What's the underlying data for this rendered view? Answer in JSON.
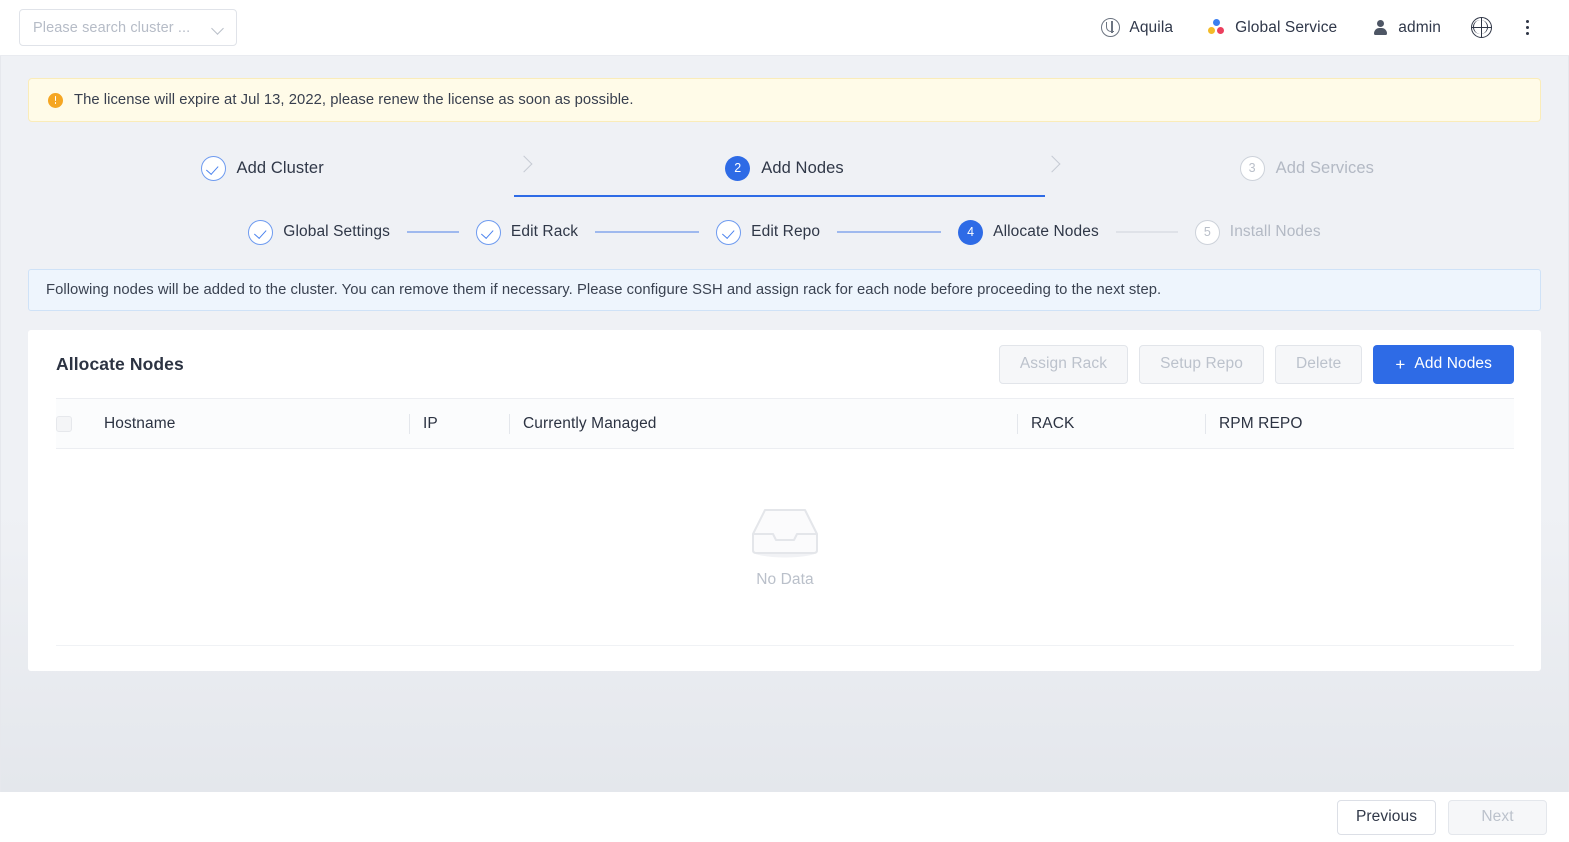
{
  "header": {
    "cluster_search": {
      "placeholder": "Please search cluster ...",
      "value": "",
      "icon": "chevron-down-icon"
    },
    "items": [
      {
        "label": "Aquila",
        "icon": "aquila-globe-icon"
      },
      {
        "label": "Global Service",
        "icon": "global-service-dots-icon"
      },
      {
        "label": "admin",
        "icon": "user-icon"
      }
    ],
    "language_icon": "globe-icon",
    "more_icon": "kebab-menu-icon"
  },
  "license_banner": {
    "icon": "warning-icon",
    "text": "The license will expire at Jul 13, 2022, please renew the license as soon as possible."
  },
  "main_steps": [
    {
      "number": "1",
      "label": "Add Cluster",
      "state": "done"
    },
    {
      "number": "2",
      "label": "Add Nodes",
      "state": "active"
    },
    {
      "number": "3",
      "label": "Add Services",
      "state": "pending"
    }
  ],
  "sub_steps": [
    {
      "number": "1",
      "label": "Global Settings",
      "state": "done"
    },
    {
      "number": "2",
      "label": "Edit Rack",
      "state": "done"
    },
    {
      "number": "3",
      "label": "Edit Repo",
      "state": "done"
    },
    {
      "number": "4",
      "label": "Allocate Nodes",
      "state": "active"
    },
    {
      "number": "5",
      "label": "Install Nodes",
      "state": "pending"
    }
  ],
  "info_banner": {
    "text": "Following nodes will be added to the cluster. You can remove them if necessary. Please configure SSH and assign rack for each node before proceeding to the next step."
  },
  "card": {
    "title": "Allocate Nodes",
    "actions": [
      {
        "label": "Assign Rack",
        "state": "disabled"
      },
      {
        "label": "Setup Repo",
        "state": "disabled"
      },
      {
        "label": "Delete",
        "state": "disabled"
      }
    ],
    "primary_action": {
      "label": "Add Nodes",
      "plus": "+",
      "state": "enabled"
    },
    "table": {
      "columns": [
        "Hostname",
        "IP",
        "Currently Managed",
        "RACK",
        "RPM REPO"
      ],
      "rows": [],
      "empty_text": "No Data",
      "empty_icon": "empty-box-icon"
    }
  },
  "footer": {
    "previous": {
      "label": "Previous",
      "state": "enabled"
    },
    "next": {
      "label": "Next",
      "state": "disabled"
    }
  },
  "colors": {
    "accent": "#2e6be6",
    "warning_bg": "#fffbe8",
    "warning_icon": "#f5a623",
    "info_bg": "#eef5fd",
    "page_bg": "#eff1f5"
  }
}
